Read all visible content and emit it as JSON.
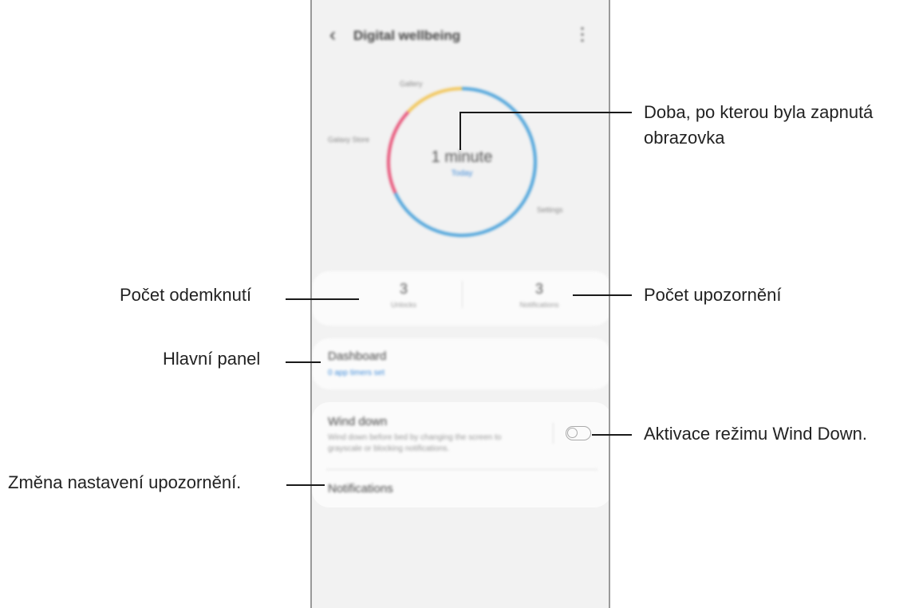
{
  "app": {
    "title": "Digital wellbeing",
    "back_icon": "chevron-left-icon",
    "more_icon": "more-vertical-icon"
  },
  "usage": {
    "value": "1 minute",
    "period": "Today",
    "legend": [
      "Gallery",
      "Galaxy Store",
      "Settings"
    ],
    "colors": {
      "Settings": "#4ea4db",
      "Galaxy Store": "#e8557a",
      "Gallery": "#f2c65a"
    }
  },
  "stats": [
    {
      "value": "3",
      "label": "Unlocks"
    },
    {
      "value": "3",
      "label": "Notifications"
    }
  ],
  "dashboard": {
    "title": "Dashboard",
    "subtitle": "0 app timers set"
  },
  "wind_down": {
    "title": "Wind down",
    "description": "Wind down before bed by changing the screen to grayscale or blocking notifications.",
    "toggle_on": false
  },
  "notifications": {
    "title": "Notifications"
  },
  "callouts": {
    "screen_time": "Doba, po kterou byla zapnutá obrazovka",
    "screen_time_line1": "Doba, po kterou byla zapnutá",
    "screen_time_line2": "obrazovka",
    "unlocks": "Počet odemknutí",
    "notifications_count": "Počet upozornění",
    "dashboard": "Hlavní panel",
    "wind_down": "Aktivace režimu Wind Down.",
    "notification_settings": "Změna nastavení upozornění."
  }
}
